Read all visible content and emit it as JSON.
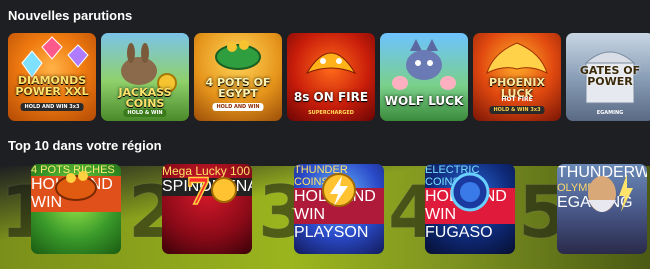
{
  "sections": {
    "new_releases": "Nouvelles parutions",
    "top10": "Top 10 dans votre région"
  },
  "new_games": [
    {
      "title": "DIAMONDS POWER XXL",
      "sub": "HOLD AND WIN 3x3",
      "provider": ""
    },
    {
      "title": "JACKASS COINS",
      "sub": "HOLD & WIN",
      "provider": ""
    },
    {
      "title": "4 POTS OF EGYPT",
      "sub": "HOLD AND WIN",
      "provider": ""
    },
    {
      "title": "8s ON FIRE",
      "sub": "SUPERCHARGED",
      "provider": ""
    },
    {
      "title": "WOLF LUCK",
      "sub": "",
      "provider": ""
    },
    {
      "title": "PHOENIX LUCK",
      "sub": "HOT FIRE",
      "provider": "HOLD & WIN 3x3"
    },
    {
      "title": "GATES OF POWER",
      "sub": "",
      "provider": "EGAMING"
    }
  ],
  "top_games": [
    {
      "rank": "1",
      "title": "4 POTS RICHES",
      "sub": "HOLD AND WIN",
      "provider": ""
    },
    {
      "rank": "2",
      "title": "Mega Lucky 100",
      "sub": "",
      "provider": "SPINOMENAL"
    },
    {
      "rank": "3",
      "title": "THUNDER COINS XXL",
      "sub": "HOLD AND WIN",
      "provider": "PLAYSON"
    },
    {
      "rank": "4",
      "title": "ELECTRIC COINS",
      "sub": "HOLD AND WIN",
      "provider": "FUGASO"
    },
    {
      "rank": "5",
      "title": "OLYMPUS",
      "sub": "THUNDERWAYS",
      "provider": "EGAMING"
    }
  ]
}
